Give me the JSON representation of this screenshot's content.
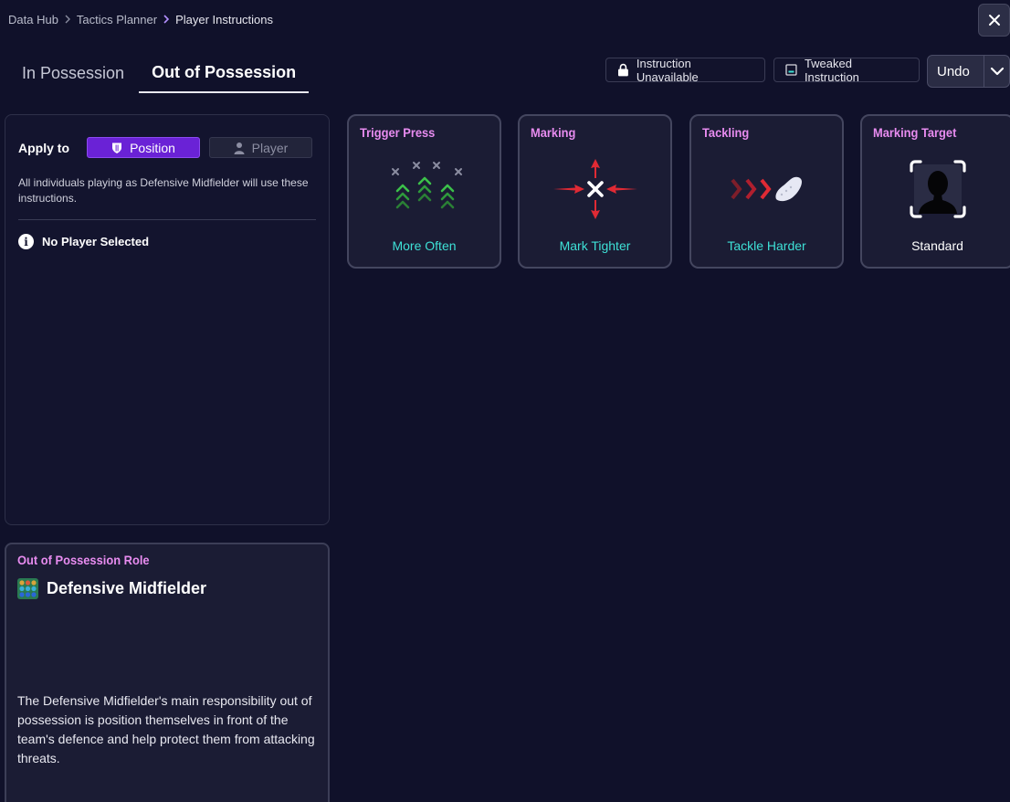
{
  "breadcrumb": {
    "items": [
      "Data Hub",
      "Tactics Planner",
      "Player Instructions"
    ]
  },
  "close": {
    "label": "✕"
  },
  "tabs": {
    "in_possession": "In Possession",
    "out_of_possession": "Out of Possession"
  },
  "legend": {
    "unavailable": "Instruction Unavailable",
    "tweaked": "Tweaked Instruction"
  },
  "undo": {
    "label": "Undo"
  },
  "apply": {
    "label": "Apply to",
    "position": "Position",
    "player": "Player",
    "description": "All individuals playing as Defensive Midfielder will use these instructions.",
    "no_player": "No Player Selected",
    "info_glyph": "i"
  },
  "role": {
    "heading": "Out of Possession Role",
    "name": "Defensive Midfielder",
    "description": "The Defensive Midfielder's main responsibility out of possession is position themselves in front of the team's defence and help protect them from attacking threats."
  },
  "cards": [
    {
      "title": "Trigger Press",
      "value": "More Often",
      "icon": "trigger-press-icon"
    },
    {
      "title": "Marking",
      "value": "Mark Tighter",
      "icon": "marking-icon"
    },
    {
      "title": "Tackling",
      "value": "Tackle Harder",
      "icon": "tackling-icon"
    },
    {
      "title": "Marking Target",
      "value": "Standard",
      "icon": "marking-target-icon"
    }
  ],
  "colors": {
    "background": "#10112a",
    "accent_purple": "#6a22d6",
    "heading_pink": "#e88cf0",
    "value_teal": "#3ee0d6",
    "arrow_green": "#3cc04a",
    "arrow_red": "#e02a34"
  }
}
